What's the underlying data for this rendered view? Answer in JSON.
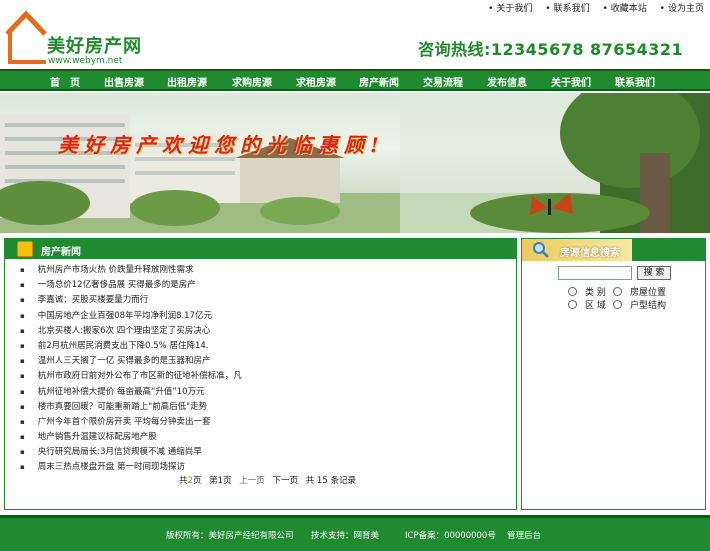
{
  "top_links": [
    "关于我们",
    "联系我们",
    "收藏本站",
    "设为主页"
  ],
  "logo": {
    "text": "美好房产网",
    "url": "www.webym.net"
  },
  "hotline": "咨询热线:12345678  87654321",
  "nav": [
    "首　页",
    "出售房源",
    "出租房源",
    "求购房源",
    "求租房源",
    "房产新闻",
    "交易流程",
    "发布信息",
    "关于我们",
    "联系我们"
  ],
  "banner": {
    "slogan": "美好房产欢迎您的光临惠顾!"
  },
  "news": {
    "title": "房产新闻",
    "items": [
      "杭州房产市场火热 价跌量升释放刚性需求",
      "一场总价12亿奢侈品展 买得最多的是房产",
      "李嘉诚：买股买楼要量力而行",
      "中国房地产企业百强08年平均净利润8.17亿元",
      "北京买楼人:搬家6次 四个理由坚定了买房决心",
      "前2月杭州居民消费支出下降0.5% 居住降14.",
      "温州人三天搁了一亿 买得最多的是玉器和房产",
      "杭州市政府日前对外公布了市区新的征地补偿标准，凡",
      "杭州征地补偿大提价 每亩最高“升值”10万元",
      "楼市真要回暖？可能重新踏上\"前高后低\"走势",
      "广州今年首个限价房开卖 平均每分钟卖出一套",
      "地产销售升温建议标配房地产股",
      "央行研究局局长:3月信贷规模不减 通缩尚早",
      "周末三热点楼盘开盘 第一时间现场探访"
    ],
    "pager": {
      "total_pages_prefix": "共",
      "total_pages": "2",
      "total_pages_suffix": "页",
      "current": "第1页",
      "prev": "上一页",
      "next": "下一页",
      "total_records": "共 15 条记录"
    }
  },
  "search": {
    "title": "房源信息搜索",
    "button": "搜 索",
    "options": [
      "类 别",
      "房屋位置",
      "区 域",
      "户型结构"
    ]
  },
  "footer": {
    "copyright": "版权所有：美好房产经纪有限公司",
    "support": "技术支持：网育美",
    "icp": "ICP备案：00000000号",
    "admin": "管理后台"
  },
  "colors": {
    "primary_green": "#1f8a2f",
    "dark_green": "#0c5c18",
    "logo_orange": "#e66c1c",
    "slogan_red": "#d7261c"
  }
}
